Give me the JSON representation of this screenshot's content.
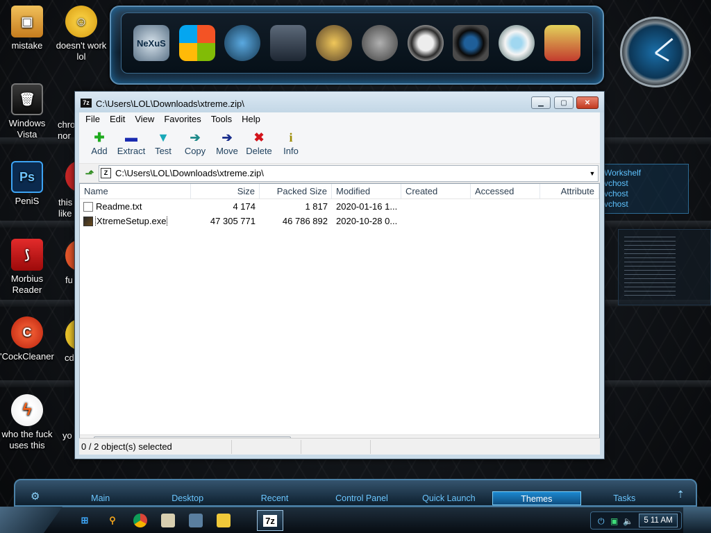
{
  "desktop": {
    "icons": [
      {
        "label": "mistake"
      },
      {
        "label": "doesn't work lol"
      },
      {
        "label": "Windows Vista"
      },
      {
        "label": "PeniS"
      },
      {
        "label": "Morbius Reader"
      },
      {
        "label": "'CockCleaner"
      },
      {
        "label": "who the fuck uses this"
      }
    ],
    "peek_labels": [
      "chro",
      "nor",
      "this",
      "like",
      "fu",
      "cd",
      "yo"
    ],
    "ps_badge": "Ps",
    "dock_brand": "NeXuS",
    "gadget_lines": [
      "Workshelf",
      "vchost",
      "vchost",
      "vchost"
    ]
  },
  "window": {
    "title": "C:\\Users\\LOL\\Downloads\\xtreme.zip\\",
    "app_icon": "7z",
    "controls": {
      "minimize": "minimize-icon",
      "maximize": "maximize-icon",
      "close": "close-icon"
    },
    "menu": [
      "File",
      "Edit",
      "View",
      "Favorites",
      "Tools",
      "Help"
    ],
    "toolbar": [
      {
        "label": "Add",
        "icon": "add-icon",
        "glyph": "✚",
        "color": "#1faa1f"
      },
      {
        "label": "Extract",
        "icon": "extract-icon",
        "glyph": "▬",
        "color": "#1a2bb0"
      },
      {
        "label": "Test",
        "icon": "test-icon",
        "glyph": "▼",
        "color": "#19a8b8"
      },
      {
        "label": "Copy",
        "icon": "copy-icon",
        "glyph": "➔",
        "color": "#1f8a8a"
      },
      {
        "label": "Move",
        "icon": "move-icon",
        "glyph": "➔",
        "color": "#1a2e8c"
      },
      {
        "label": "Delete",
        "icon": "delete-icon",
        "glyph": "✖",
        "color": "#d3141c"
      },
      {
        "label": "Info",
        "icon": "info-icon",
        "glyph": "i",
        "color": "#9b8a00"
      }
    ],
    "address": {
      "path": "C:\\Users\\LOL\\Downloads\\xtreme.zip\\",
      "zip_icon": "Z"
    },
    "columns": [
      "Name",
      "Size",
      "Packed Size",
      "Modified",
      "Created",
      "Accessed",
      "Attribute"
    ],
    "files": [
      {
        "name": "Readme.txt",
        "size": "4 174",
        "packed": "1 817",
        "modified": "2020-01-16 1...",
        "created": "",
        "accessed": "",
        "attr": "",
        "type": "txt"
      },
      {
        "name": "XtremeSetup.exe",
        "size": "47 305 771",
        "packed": "46 786 892",
        "modified": "2020-10-28 0...",
        "created": "",
        "accessed": "",
        "attr": "",
        "type": "exe"
      }
    ],
    "status": "0 / 2 object(s) selected"
  },
  "bottom_dock": {
    "tabs": [
      "Main",
      "Desktop",
      "Recent",
      "Control Panel",
      "Quick Launch",
      "Themes",
      "Tasks"
    ],
    "active_tab": "Themes"
  },
  "taskbar": {
    "active_app": "7z",
    "clock": "5 11 AM"
  }
}
